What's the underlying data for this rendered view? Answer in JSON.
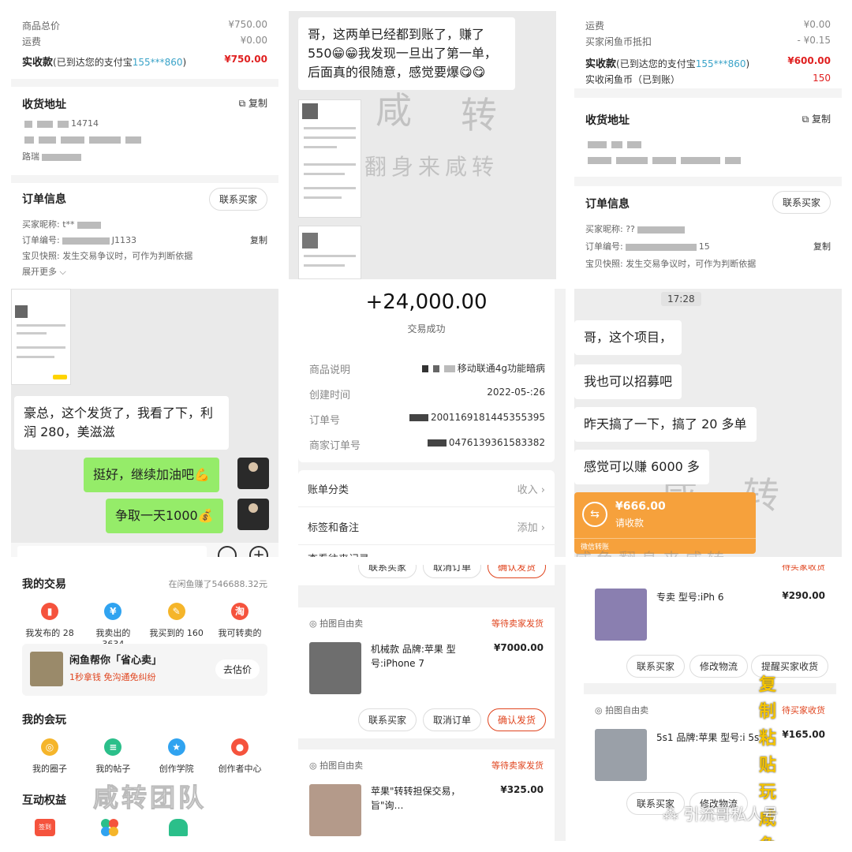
{
  "panel1": {
    "goods_total_label": "商品总价",
    "goods_total_value": "¥750.00",
    "shipping_label": "运费",
    "shipping_value": "¥0.00",
    "paid_label": "实收款",
    "paid_note_prefix": "(已到达您的支付宝",
    "paid_account": "155***860",
    "paid_note_suffix": ")",
    "paid_value": "¥750.00",
    "address_title": "收货地址",
    "copy_label": "复制",
    "address_fragment1": "14714",
    "address_fragment2": "路瑞",
    "order_info_title": "订单信息",
    "contact_buyer": "联系买家",
    "buyer_nick_label": "买家昵称:",
    "buyer_nick_value": "t**",
    "order_no_label": "订单编号:",
    "order_no_value": "J1133",
    "order_copy": "复制",
    "snapshot_label": "宝贝快照:",
    "snapshot_text": "发生交易争议时，可作为判断依据",
    "expand_more": "展开更多"
  },
  "panel2": {
    "bubble_text": "哥，这两单已经都到账了，赚了550😁😁我发现一旦出了第一单，后面真的很随意，感觉要爆😋😋",
    "watermark_char1": "咸",
    "watermark_char2": "转",
    "watermark_slogan": "翻身来咸转"
  },
  "panel3": {
    "shipping_label": "运费",
    "shipping_value": "¥0.00",
    "coin_deduct_label": "买家闲鱼币抵扣",
    "coin_deduct_value": "- ¥0.15",
    "paid_label": "实收款",
    "paid_note_prefix": "(已到达您的支付宝",
    "paid_account": "155***860",
    "paid_note_suffix": ")",
    "paid_value": "¥600.00",
    "coin_received_label": "实收闲鱼币（已到账）",
    "coin_received_value": "150",
    "address_title": "收货地址",
    "copy_label": "复制",
    "order_info_title": "订单信息",
    "contact_buyer": "联系买家",
    "buyer_nick_label": "买家昵称:",
    "buyer_nick_value": "??",
    "order_no_label": "订单编号:",
    "order_no_value": "15",
    "order_copy": "复制",
    "snapshot_label": "宝贝快照:",
    "snapshot_text": "发生交易争议时，可作为判断依据"
  },
  "panel4": {
    "bubble1": "豪总，这个发货了，我看了下，利润 280，美滋滋",
    "bubble2": "挺好，继续加油吧💪",
    "bubble3": "争取一天1000💰"
  },
  "panel5": {
    "amount": "+24,000.00",
    "status": "交易成功",
    "desc_label": "商品说明",
    "desc_value": "移动联通4g功能暗病",
    "created_label": "创建时间",
    "created_value": "2022-05-:26",
    "order_no_label": "订单号",
    "order_no_value": "2001169181445355395",
    "merchant_no_label": "商家订单号",
    "merchant_no_value": "0476139361583382",
    "category_label": "账单分类",
    "category_value": "收入",
    "tags_label": "标签和备注",
    "tags_value": "添加",
    "more_label": "查看往来记录"
  },
  "panel6": {
    "time": "17:28",
    "bubble1": "哥，这个项目，",
    "bubble2": "我也可以招募吧",
    "bubble3": "昨天搞了一下，搞了 20 多单",
    "bubble4": "感觉可以赚 6000 多",
    "transfer_amount": "¥666.00",
    "transfer_action": "请收款",
    "transfer_source": "微信转账",
    "watermark_char1": "咸",
    "watermark_char2": "转",
    "watermark_slogan": "咸鱼翻身来咸转"
  },
  "panel7": {
    "my_trades_title": "我的交易",
    "earned_text": "在闲鱼赚了546688.32元",
    "trade_items": [
      {
        "label": "我发布的 28",
        "icon": "bag-icon",
        "color": "#f5533d",
        "glyph": "▮"
      },
      {
        "label": "我卖出的 3634",
        "icon": "yen-icon",
        "color": "#30a3f0",
        "glyph": "¥"
      },
      {
        "label": "我买到的 160",
        "icon": "edit-icon",
        "color": "#f5b52a",
        "glyph": "✎"
      },
      {
        "label": "我可转卖的",
        "icon": "resell-icon",
        "color": "#f5533d",
        "glyph": "淘"
      }
    ],
    "promo_title": "闲鱼帮你「省心卖」",
    "promo_sub": "1秒拿钱 免沟通免纠纷",
    "promo_button": "去估价",
    "play_title": "我的会玩",
    "play_items": [
      {
        "label": "我的圈子",
        "icon": "circle-icon",
        "color": "#f5b52a",
        "glyph": "◎"
      },
      {
        "label": "我的帖子",
        "icon": "post-icon",
        "color": "#2bbf8a",
        "glyph": "≡"
      },
      {
        "label": "创作学院",
        "icon": "star-icon",
        "color": "#30a3f0",
        "glyph": "★"
      },
      {
        "label": "创作者中心",
        "icon": "balloon-icon",
        "color": "#f5533d",
        "glyph": "●"
      }
    ],
    "benefits_title": "互动权益",
    "team_watermark": "咸转团队",
    "signin_badge": "签到"
  },
  "panel8": {
    "top_buttons": [
      "联系买家",
      "取消订单",
      "确认发货"
    ],
    "orders": [
      {
        "source": "拍图自由卖",
        "status": "等待卖家发货",
        "name": "机械款 品牌:苹果 型号:iPhone 7",
        "price": "¥7000.00",
        "buttons": [
          "联系买家",
          "取消订单",
          "确认发货"
        ]
      },
      {
        "source": "拍图自由卖",
        "status": "等待卖家发货",
        "name": "苹果\"转转担保交易，旨\"询…",
        "price": "¥325.00"
      }
    ]
  },
  "panel9": {
    "top_status": "待买家收货",
    "orders": [
      {
        "name": "专卖 型号:iPh 6",
        "price": "¥290.00",
        "buttons": [
          "联系买家",
          "修改物流",
          "提醒买家收货"
        ]
      },
      {
        "source": "拍图自由卖",
        "status": "待买家收货",
        "name": "5s1 品牌:苹果 型号:i 5s",
        "price": "¥165.00",
        "buttons": [
          "联系买家",
          "修改物流"
        ]
      }
    ],
    "side_watermark": "复制粘贴玩咸鱼",
    "wechat_watermark": "引流哥私人号"
  }
}
